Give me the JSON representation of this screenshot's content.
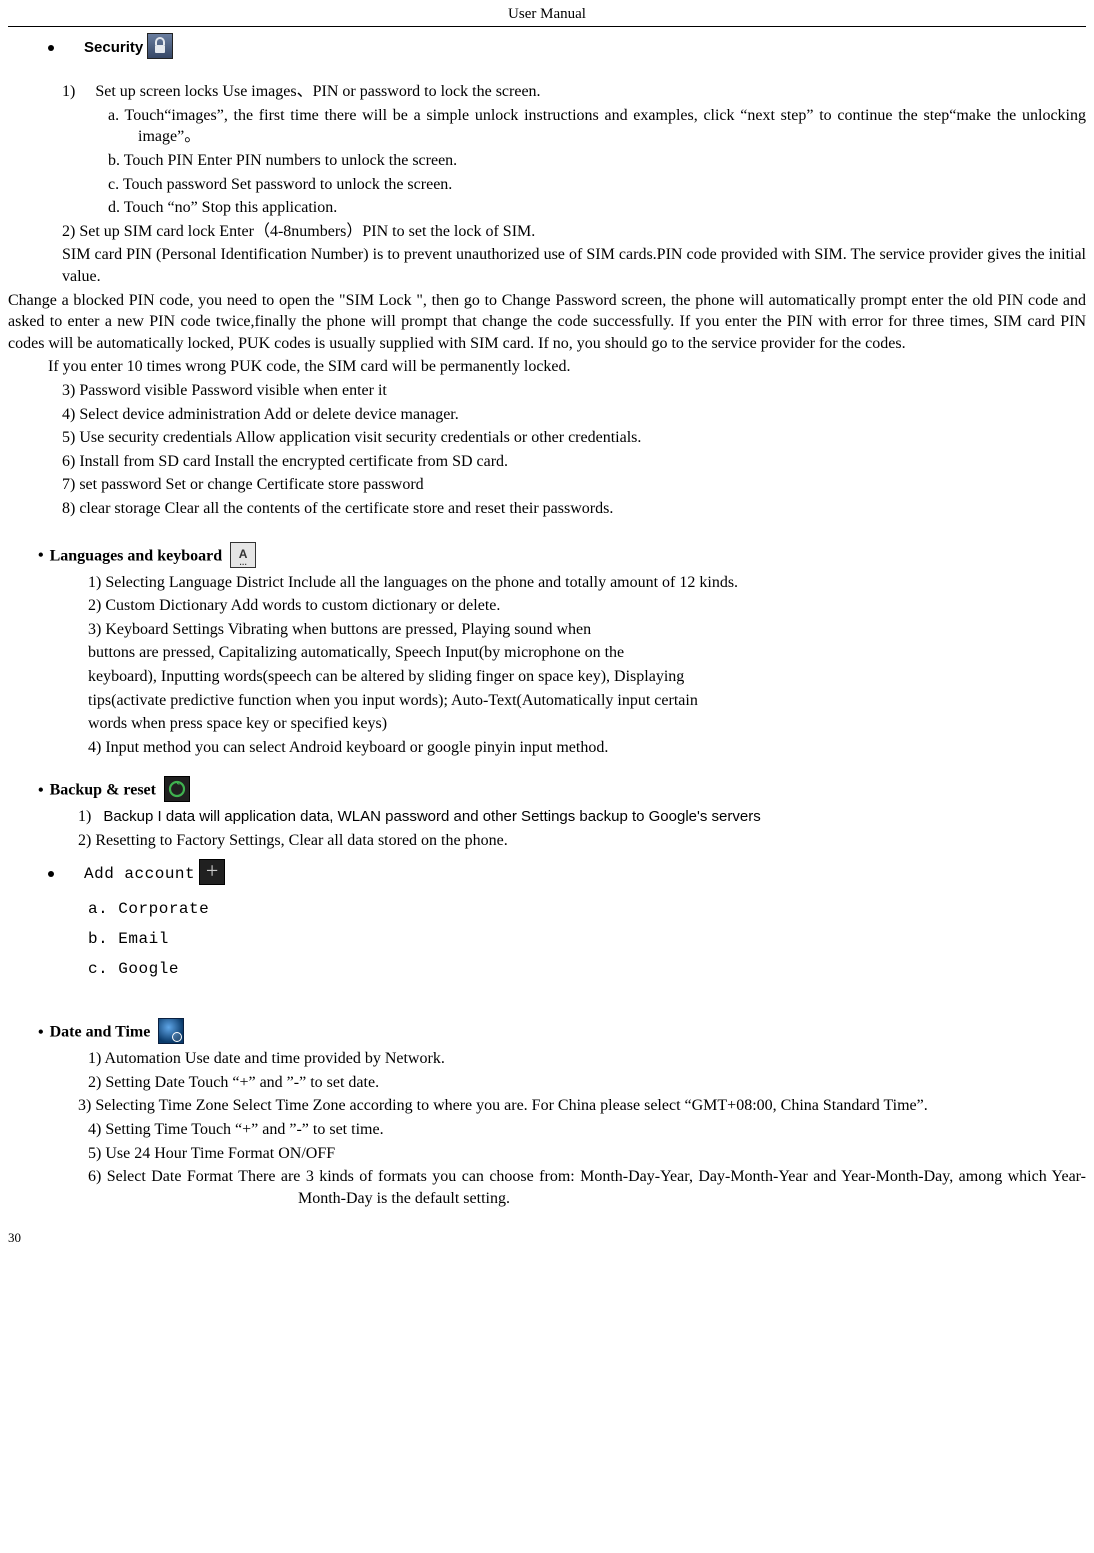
{
  "header": "User    Manual",
  "page_number": "30",
  "security": {
    "label": "Security",
    "item1_lead": "1)　 Set up screen locks      Use images、PIN or password to lock the screen.",
    "item1a": "a. Touch“images”,    the first time there will be a simple unlock instructions and examples, click  “next step” to continue the step“make the unlocking image”。",
    "item1b": "b. Touch PIN Enter PIN numbers to unlock the screen.",
    "item1c": "c. Touch password      Set password to unlock the screen.",
    "item1d": "d. Touch “no”      Stop this application.",
    "item2": "2)    Set up SIM card lock      Enter（4-8numbers）PIN to set the lock of SIM.",
    "sim_para1": "SIM card PIN (Personal Identification Number) is to prevent unauthorized use of SIM cards.PIN code provided with SIM. The service provider gives the initial value.",
    "sim_para2": "Change a blocked PIN code, you need to open the \"SIM Lock \", then go to Change Password screen, the phone will automatically prompt enter the old PIN code and asked to enter a new PIN code twice,finally the phone will prompt that change the code successfully. If you enter the PIN with error for three times, SIM card PIN codes will be automatically locked, PUK codes is usually supplied with SIM card. If no, you should go to the service provider for the codes.",
    "sim_para3": "If you enter 10 times wrong PUK code, the SIM card will be permanently locked.",
    "item3": "3)    Password visible        Password visible when enter it",
    "item4": "4)    Select device administration      Add or delete device manager.",
    "item5": "5)    Use security credentials        Allow application visit security credentials or other credentials.",
    "item6": "6)    Install from SD card      Install the encrypted certificate from SD card.",
    "item7": "7)    set password        Set or change Certificate store password",
    "item8": "8)    clear storage        Clear all the contents of the certificate store and reset their passwords."
  },
  "languages": {
    "label": "Languages and keyboard",
    "l1": "1) Selecting Language District        Include all the languages on the phone and totally amount of 12 kinds.",
    "l2": "2) Custom Dictionary          Add words to custom dictionary or delete.",
    "l3": "3) Keyboard Settings        Vibrating when buttons are pressed, Playing sound when",
    "l3b": "buttons are pressed, Capitalizing automatically, Speech Input(by microphone on the",
    "l3c": "keyboard), Inputting words(speech can be altered by sliding finger on space key), Displaying",
    "l3d": "tips(activate predictive function when you input words); Auto-Text(Automatically input certain",
    "l3e": "words when press space key or specified keys)",
    "l4": "4) Input method        you can select Android keyboard or google pinyin input method."
  },
  "backup": {
    "label": "Backup & reset",
    "b1": "Backup I data will application data, WLAN password and other Settings backup to Google's servers",
    "b2": "2)    Resetting to Factory Settings, Clear all data stored on the phone."
  },
  "addaccount": {
    "label": "Add account",
    "a": "a.  Corporate",
    "b": "b.  Email",
    "c": "c.  Google"
  },
  "datetime": {
    "label": "Date and Time",
    "d1": "1) Automation        Use date and time provided by Network.",
    "d2": "2) Setting Date        Touch “+” and ”-” to set date.",
    "d3a": "3) Selecting Time Zone        Select Time Zone according to where you are. For China please select “GMT+08:00, China Standard Time”.",
    "d4": "4) Setting Time        Touch “+” and ”-” to set time.",
    "d5": "5) Use 24 Hour Time Format        ON/OFF",
    "d6a": "6) Select Date Format        There are 3 kinds of formats you can choose from: Month-Day-Year, Day-Month-Year and Year-Month-Day, among which Year-Month-Day is the default setting."
  }
}
